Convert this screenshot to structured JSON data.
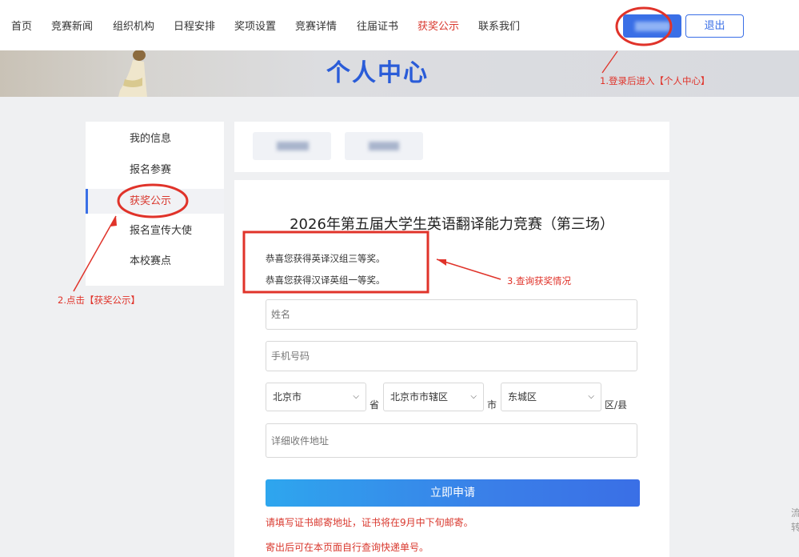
{
  "nav": {
    "items": [
      "首页",
      "竞赛新闻",
      "组织机构",
      "日程安排",
      "奖项设置",
      "竞赛详情",
      "往届证书",
      "获奖公示",
      "联系我们"
    ],
    "active_index": 7,
    "logout_label": "退出"
  },
  "banner": {
    "title": "个人中心"
  },
  "sidebar": {
    "items": [
      "我的信息",
      "报名参赛",
      "获奖公示",
      "报名宣传大使",
      "本校赛点"
    ],
    "active_index": 2
  },
  "contest": {
    "title": "2026年第五届大学生英语翻译能力竞赛（第三场）",
    "awards": [
      "恭喜您获得英译汉组三等奖。",
      "恭喜您获得汉译英组一等奖。"
    ]
  },
  "form": {
    "name_placeholder": "姓名",
    "phone_placeholder": "手机号码",
    "province": "北京市",
    "province_unit": "省",
    "city": "北京市市辖区",
    "city_unit": "市",
    "district": "东城区",
    "district_unit": "区/县",
    "address_placeholder": "详细收件地址",
    "submit_label": "立即申请"
  },
  "notes": [
    "请填写证书邮寄地址，证书将在9月中下旬邮寄。",
    "寄出后可在本页面自行查询快递单号。"
  ],
  "annotations": {
    "step1": "1.登录后进入【个人中心】",
    "step2": "2.点击【获奖公示】",
    "step3": "3.查询获奖情况",
    "color": "#e0332a"
  },
  "edge": {
    "line1": "流",
    "line2": "转"
  },
  "colors": {
    "accent": "#3a6fe6",
    "active": "#d9382e"
  }
}
